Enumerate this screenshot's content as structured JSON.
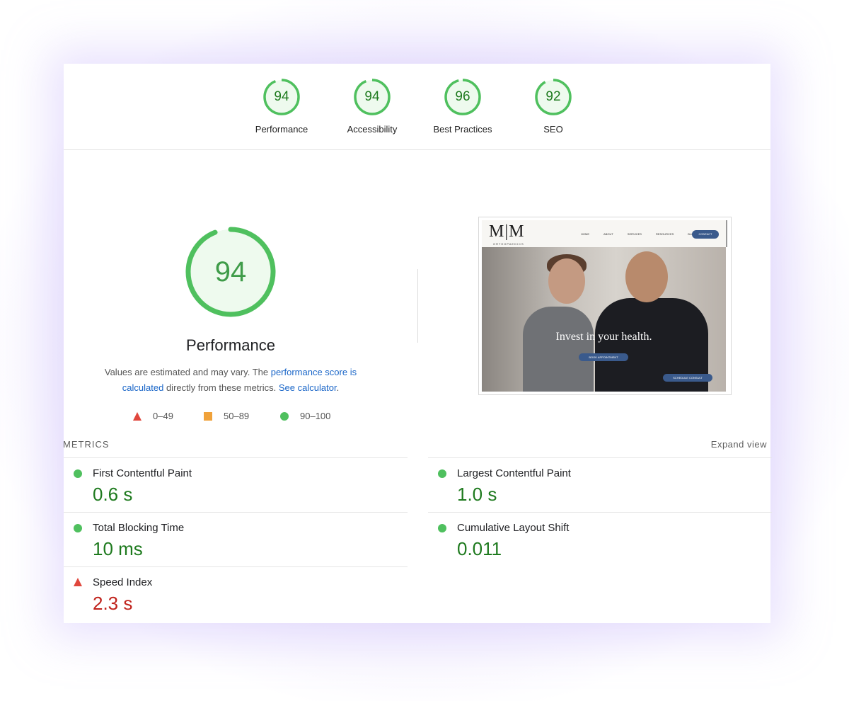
{
  "summary": [
    {
      "score": "94",
      "label": "Performance",
      "fraction": 0.94
    },
    {
      "score": "94",
      "label": "Accessibility",
      "fraction": 0.94
    },
    {
      "score": "96",
      "label": "Best Practices",
      "fraction": 0.96
    },
    {
      "score": "92",
      "label": "SEO",
      "fraction": 0.92
    }
  ],
  "main": {
    "score": "94",
    "fraction": 0.94,
    "title": "Performance",
    "desc_prefix": "Values are estimated and may vary. The ",
    "desc_link1": "performance score is calculated",
    "desc_mid": " directly from these metrics. ",
    "desc_link2": "See calculator",
    "desc_suffix": "."
  },
  "legend": {
    "fail": "0–49",
    "average": "50–89",
    "pass": "90–100"
  },
  "thumbnail": {
    "logo": "M|M",
    "logo_sub": "ORTHOPAEDICS",
    "nav": [
      "HOME",
      "ABOUT",
      "SERVICES",
      "RESOURCES",
      "BLOG"
    ],
    "contact": "CONTACT",
    "tagline": "Invest in your health.",
    "btn_primary": "BOOK APPOINTMENT",
    "btn_secondary": "SCHEDULE CONSULT"
  },
  "metrics": {
    "heading": "METRICS",
    "expand": "Expand view",
    "items": [
      {
        "name": "First Contentful Paint",
        "value": "0.6 s",
        "status": "pass"
      },
      {
        "name": "Largest Contentful Paint",
        "value": "1.0 s",
        "status": "pass"
      },
      {
        "name": "Total Blocking Time",
        "value": "10 ms",
        "status": "pass"
      },
      {
        "name": "Cumulative Layout Shift",
        "value": "0.011",
        "status": "pass"
      },
      {
        "name": "Speed Index",
        "value": "2.3 s",
        "status": "fail"
      }
    ]
  },
  "colors": {
    "pass": "#4fc05e",
    "pass_text": "#1e7a1e",
    "average": "#f0a23a",
    "fail": "#e0473d",
    "fail_text": "#c0221b",
    "link": "#1a66c8"
  }
}
